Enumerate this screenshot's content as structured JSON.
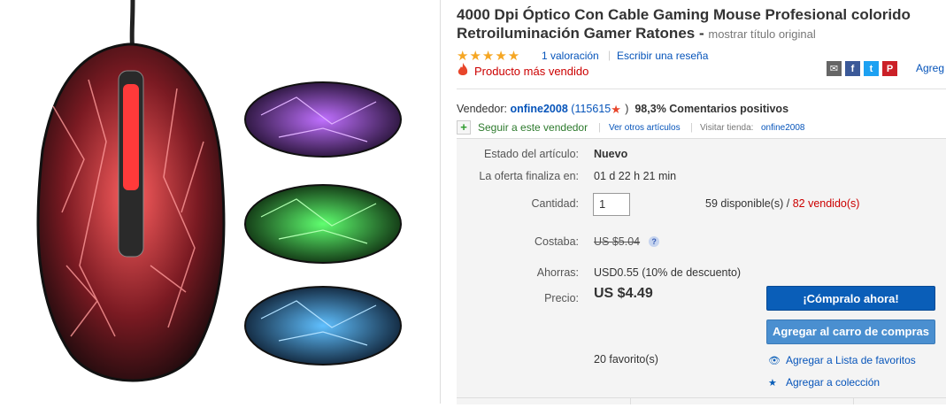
{
  "listing": {
    "title": "4000 Dpi Óptico Con Cable Gaming Mouse Profesional colorido Retroiluminación Gamer Ratones -",
    "title_note": "mostrar título original",
    "stars": "★★★★★",
    "rating_text": "1 valoración",
    "review_link": "Escribir una reseña",
    "bestseller": "Producto más vendido",
    "share_more": "Agreg"
  },
  "seller": {
    "label": "Vendedor:",
    "name": "onfine2008",
    "feedback_count": "(115615",
    "feedback_pct": "98,3% Comentarios positivos",
    "follow": "Seguir a este vendedor",
    "other_items": "Ver otros artículos",
    "visit_store_label": "Visitar tienda:",
    "store_name": "onfine2008"
  },
  "details": {
    "condition_label": "Estado del artículo:",
    "condition_value": "Nuevo",
    "ends_label": "La oferta finaliza en:",
    "ends_value": "01 d 22 h 21 min",
    "qty_label": "Cantidad:",
    "qty_value": "1",
    "available": "59 disponible(s) /",
    "sold": "82 vendido(s)",
    "was_label": "Costaba:",
    "was_value": "US $5.04",
    "save_label": "Ahorras:",
    "save_value": "USD0.55 (10% de descuento)",
    "price_label": "Precio:",
    "price_value": "US $4.49",
    "buy_now": "¡Cómpralo ahora!",
    "add_cart": "Agregar al carro de compras",
    "favorites": "20 favorito(s)",
    "add_watchlist": "Agregar a Lista de favoritos",
    "add_collection": "Agregar a colección"
  },
  "colors": {
    "link": "#0654ba",
    "buy": "#0a5eb8",
    "cart": "#4a8fd0",
    "red": "#cc0000"
  },
  "icons": [
    "star-icon",
    "fire-icon",
    "email-icon",
    "facebook-icon",
    "twitter-icon",
    "pinterest-icon",
    "plus-icon",
    "help-icon",
    "eye-icon",
    "star-small-icon"
  ]
}
